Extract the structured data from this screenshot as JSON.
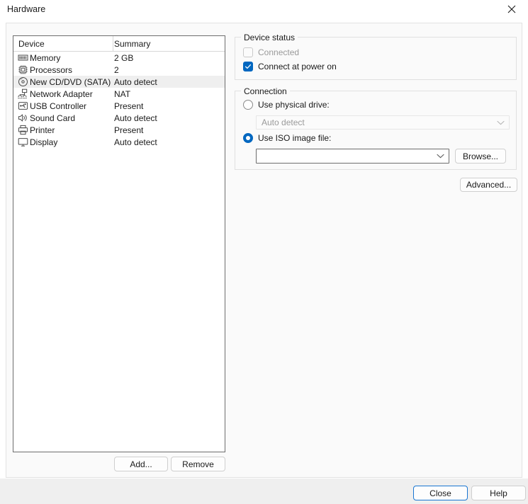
{
  "window": {
    "title": "Hardware",
    "close_icon": "close-x-icon"
  },
  "device_list": {
    "columns": {
      "device": "Device",
      "summary": "Summary"
    },
    "rows": [
      {
        "icon": "memory-icon",
        "name": "Memory",
        "summary": "2 GB",
        "selected": false
      },
      {
        "icon": "processor-chip-icon",
        "name": "Processors",
        "summary": "2",
        "selected": false
      },
      {
        "icon": "cd-dvd-disc-icon",
        "name": "New CD/DVD (SATA)",
        "summary": "Auto detect",
        "selected": true
      },
      {
        "icon": "network-adapter-icon",
        "name": "Network Adapter",
        "summary": "NAT",
        "selected": false
      },
      {
        "icon": "usb-controller-icon",
        "name": "USB Controller",
        "summary": "Present",
        "selected": false
      },
      {
        "icon": "sound-card-icon",
        "name": "Sound Card",
        "summary": "Auto detect",
        "selected": false
      },
      {
        "icon": "printer-icon",
        "name": "Printer",
        "summary": "Present",
        "selected": false
      },
      {
        "icon": "display-monitor-icon",
        "name": "Display",
        "summary": "Auto detect",
        "selected": false
      }
    ],
    "add_label": "Add...",
    "remove_label": "Remove"
  },
  "device_status": {
    "title": "Device status",
    "connected": {
      "label": "Connected",
      "checked": false,
      "disabled": true
    },
    "connect_at_power_on": {
      "label": "Connect at power on",
      "checked": true,
      "disabled": false
    }
  },
  "connection": {
    "title": "Connection",
    "use_physical_drive": {
      "label": "Use physical drive:",
      "selected": false
    },
    "physical_drive_value": "Auto detect",
    "use_iso_image": {
      "label": "Use ISO image file:",
      "selected": true
    },
    "iso_value": "",
    "iso_placeholder": "",
    "browse_label": "Browse..."
  },
  "advanced_label": "Advanced...",
  "footer": {
    "close_label": "Close",
    "help_label": "Help"
  },
  "colors": {
    "accent": "#0067c0",
    "focus_border": "#1976d2",
    "selection_row": "#efefef",
    "panel_bg": "#fafafa",
    "footer_bg": "#efefef",
    "disabled_text": "#9a9a9a"
  }
}
